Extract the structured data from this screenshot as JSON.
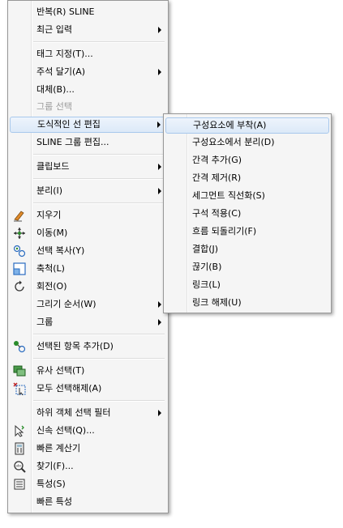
{
  "main_menu": {
    "items": [
      {
        "label": "반복(R) SLINE"
      },
      {
        "label": "최근 입력"
      },
      {
        "label": "태그 지정(T)..."
      },
      {
        "label": "주석 달기(A)"
      },
      {
        "label": "대체(B)..."
      },
      {
        "label": "그룹 선택"
      },
      {
        "label": "도식적인 선 편집"
      },
      {
        "label": "SLINE 그룹 편집..."
      },
      {
        "label": "클립보드"
      },
      {
        "label": "분리(I)"
      },
      {
        "label": "지우기",
        "icon": "eraser-icon"
      },
      {
        "label": "이동(M)",
        "icon": "move-icon"
      },
      {
        "label": "선택 복사(Y)",
        "icon": "copy-icon"
      },
      {
        "label": "축척(L)",
        "icon": "scale-icon"
      },
      {
        "label": "회전(O)",
        "icon": "rotate-icon"
      },
      {
        "label": "그리기 순서(W)"
      },
      {
        "label": "그룹"
      },
      {
        "label": "선택된 항목 추가(D)",
        "icon": "add-selected-icon"
      },
      {
        "label": "유사 선택(T)",
        "icon": "select-similar-icon"
      },
      {
        "label": "모두 선택해제(A)",
        "icon": "deselect-all-icon"
      },
      {
        "label": "하위 객체 선택 필터"
      },
      {
        "label": "신속 선택(Q)...",
        "icon": "quick-select-icon"
      },
      {
        "label": "빠른 계산기",
        "icon": "calculator-icon"
      },
      {
        "label": "찾기(F)...",
        "icon": "find-icon"
      },
      {
        "label": "특성(S)",
        "icon": "properties-icon"
      },
      {
        "label": "빠른 특성"
      }
    ]
  },
  "sub_menu": {
    "items": [
      {
        "label": "구성요소에 부착(A)"
      },
      {
        "label": "구성요소에서 분리(D)"
      },
      {
        "label": "간격 추가(G)"
      },
      {
        "label": "간격 제거(R)"
      },
      {
        "label": "세그먼트 직선화(S)"
      },
      {
        "label": "구석 적용(C)"
      },
      {
        "label": "흐름 되돌리기(F)"
      },
      {
        "label": "결합(J)"
      },
      {
        "label": "끊기(B)"
      },
      {
        "label": "링크(L)"
      },
      {
        "label": "링크 해제(U)"
      }
    ]
  }
}
